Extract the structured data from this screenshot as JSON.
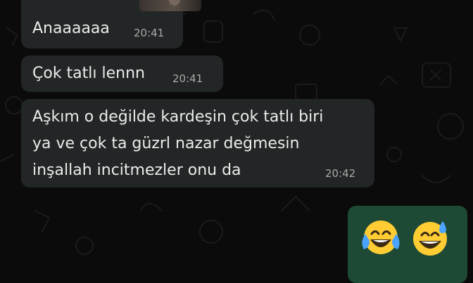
{
  "chat": {
    "messages": [
      {
        "text": "Anaaaaaa",
        "time": "20:41"
      },
      {
        "text": "Çok tatlı lennn",
        "time": "20:41"
      },
      {
        "lines": [
          "Aşkım o değilde kardeşin çok tatlı biri",
          "ya ve çok ta güzrl nazar değmesin",
          "inşallah incitmezler onu da"
        ],
        "time": "20:42"
      }
    ],
    "outgoing_emojis": [
      "face-with-tears-of-joy",
      "grinning-face-with-sweat"
    ]
  },
  "colors": {
    "wallpaper": "#0b0b0b",
    "incoming_bubble": "#232626",
    "outgoing_bubble": "#1e4a35",
    "timestamp": "#a6aaa8"
  }
}
